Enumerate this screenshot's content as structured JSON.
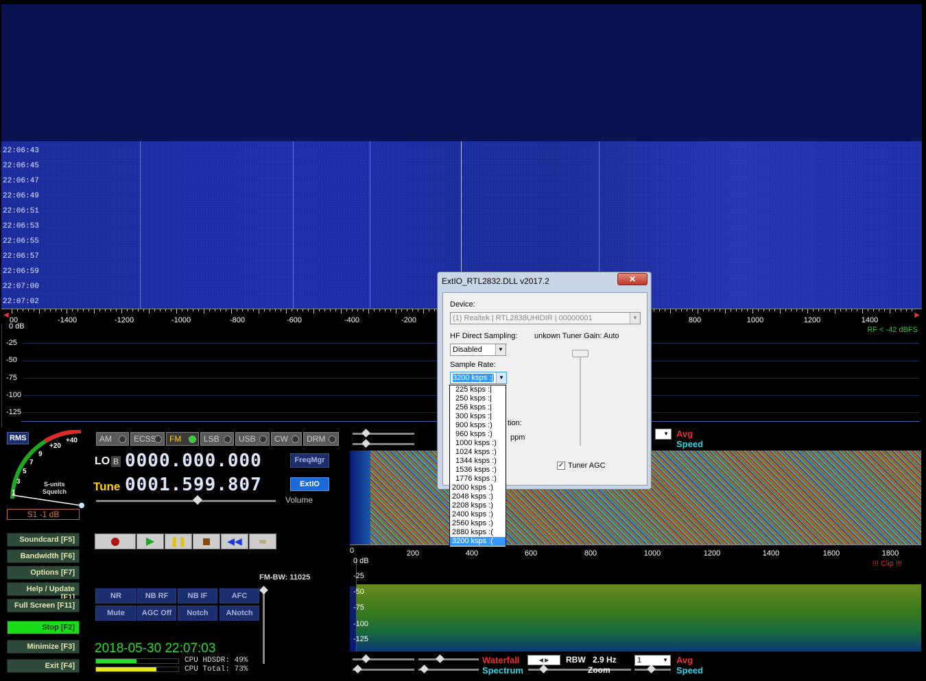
{
  "waterfall": {
    "timestamps": [
      "22:06:43",
      "22:06:45",
      "22:06:47",
      "22:06:49",
      "22:06:51",
      "22:06:53",
      "22:06:55",
      "22:06:57",
      "22:06:59",
      "22:07:00",
      "22:07:02"
    ]
  },
  "axis1": {
    "labels": [
      "-1400",
      "-1200",
      "-1000",
      "-800",
      "-600",
      "-400",
      "-200",
      "800",
      "1000",
      "1200",
      "1400"
    ],
    "first_label": "00"
  },
  "spectrum1": {
    "db_labels": [
      "0 dB",
      "-25",
      "-50",
      "-75",
      "-100",
      "-125"
    ],
    "rf_status": "RF < -42 dBFS"
  },
  "dialog": {
    "title": "ExtIO_RTL2832.DLL v2017.2",
    "close": "✕",
    "device_label": "Device:",
    "device_value": "(1) Realtek | RTL2838UHIDIR | 00000001",
    "hf_label": "HF Direct Sampling:",
    "hf_value": "Disabled",
    "tuner_gain_label": "unkown Tuner Gain: Auto",
    "sample_rate_label": "Sample Rate:",
    "sample_rate_value": "3200 ksps :(",
    "correction_label": "tion:",
    "ppm_label": "ppm",
    "tuner_agc_label": "Tuner AGC",
    "rates": [
      "225 ksps :|",
      "250 ksps :|",
      "256 ksps :|",
      "300 ksps :|",
      "900 ksps :)",
      "960 ksps :)",
      "1000 ksps :)",
      "1024 ksps :)",
      "1344 ksps :)",
      "1536 ksps :)",
      "1776 ksps :)",
      "2000 ksps :)",
      "2048 ksps :)",
      "2208 ksps :)",
      "2400 ksps :)",
      "2560 ksps :)",
      "2880 ksps :(",
      "3200 ksps :("
    ]
  },
  "smeter": {
    "rms": "RMS",
    "scale": [
      "+40",
      "+20",
      "9",
      "7",
      "5",
      "3",
      "1"
    ],
    "label1": "S-units",
    "label2": "Squelch",
    "value": "S1 -1 dB"
  },
  "modes": [
    "AM",
    "ECSS",
    "FM",
    "LSB",
    "USB",
    "CW",
    "DRM"
  ],
  "lo": {
    "label": "LO",
    "b": "B",
    "value": "0000.000.000"
  },
  "tune": {
    "label": "Tune",
    "value": "0001.599.807"
  },
  "freqmgr": "FreqMgr",
  "extio": "ExtIO",
  "volume": "Volume",
  "left_buttons": {
    "soundcard": "Soundcard  [F5]",
    "bandwidth": "Bandwidth  [F6]",
    "options": "Options  [F7]",
    "help": "Help / Update  [F1]",
    "fullscreen": "Full Screen  [F11]",
    "stop": "Stop  [F2]",
    "minimize": "Minimize  [F3]",
    "exit": "Exit  [F4]"
  },
  "dsp": {
    "nr": "NR",
    "nbrf": "NB RF",
    "nbif": "NB IF",
    "afc": "AFC",
    "mute": "Mute",
    "agcoff": "AGC Off",
    "notch": "Notch",
    "anotch": "ANotch"
  },
  "fmbw": "FM-BW: 11025",
  "datetime": "2018-05-30 22:07:03",
  "cpu": {
    "hdsdr": "CPU HDSDR: 49%",
    "total": "CPU Total: 73%",
    "hdsdr_pct": 49,
    "total_pct": 73
  },
  "top_right": {
    "avg": "Avg",
    "speed": "Speed"
  },
  "axis2": {
    "labels": [
      "200",
      "400",
      "600",
      "800",
      "1000",
      "1200",
      "1400",
      "1600",
      "1800"
    ],
    "zero": "0"
  },
  "spectrum2": {
    "db_labels": [
      "0 dB",
      "-25",
      "-50",
      "-75",
      "-100",
      "-125"
    ],
    "clip": "!!! Clip !!!"
  },
  "bottom": {
    "waterfall": "Waterfall",
    "spectrum": "Spectrum",
    "rbw_label": "RBW",
    "rbw_value": "2.9 Hz",
    "zoom": "Zoom",
    "avg": "Avg",
    "speed": "Speed",
    "select": "1"
  }
}
